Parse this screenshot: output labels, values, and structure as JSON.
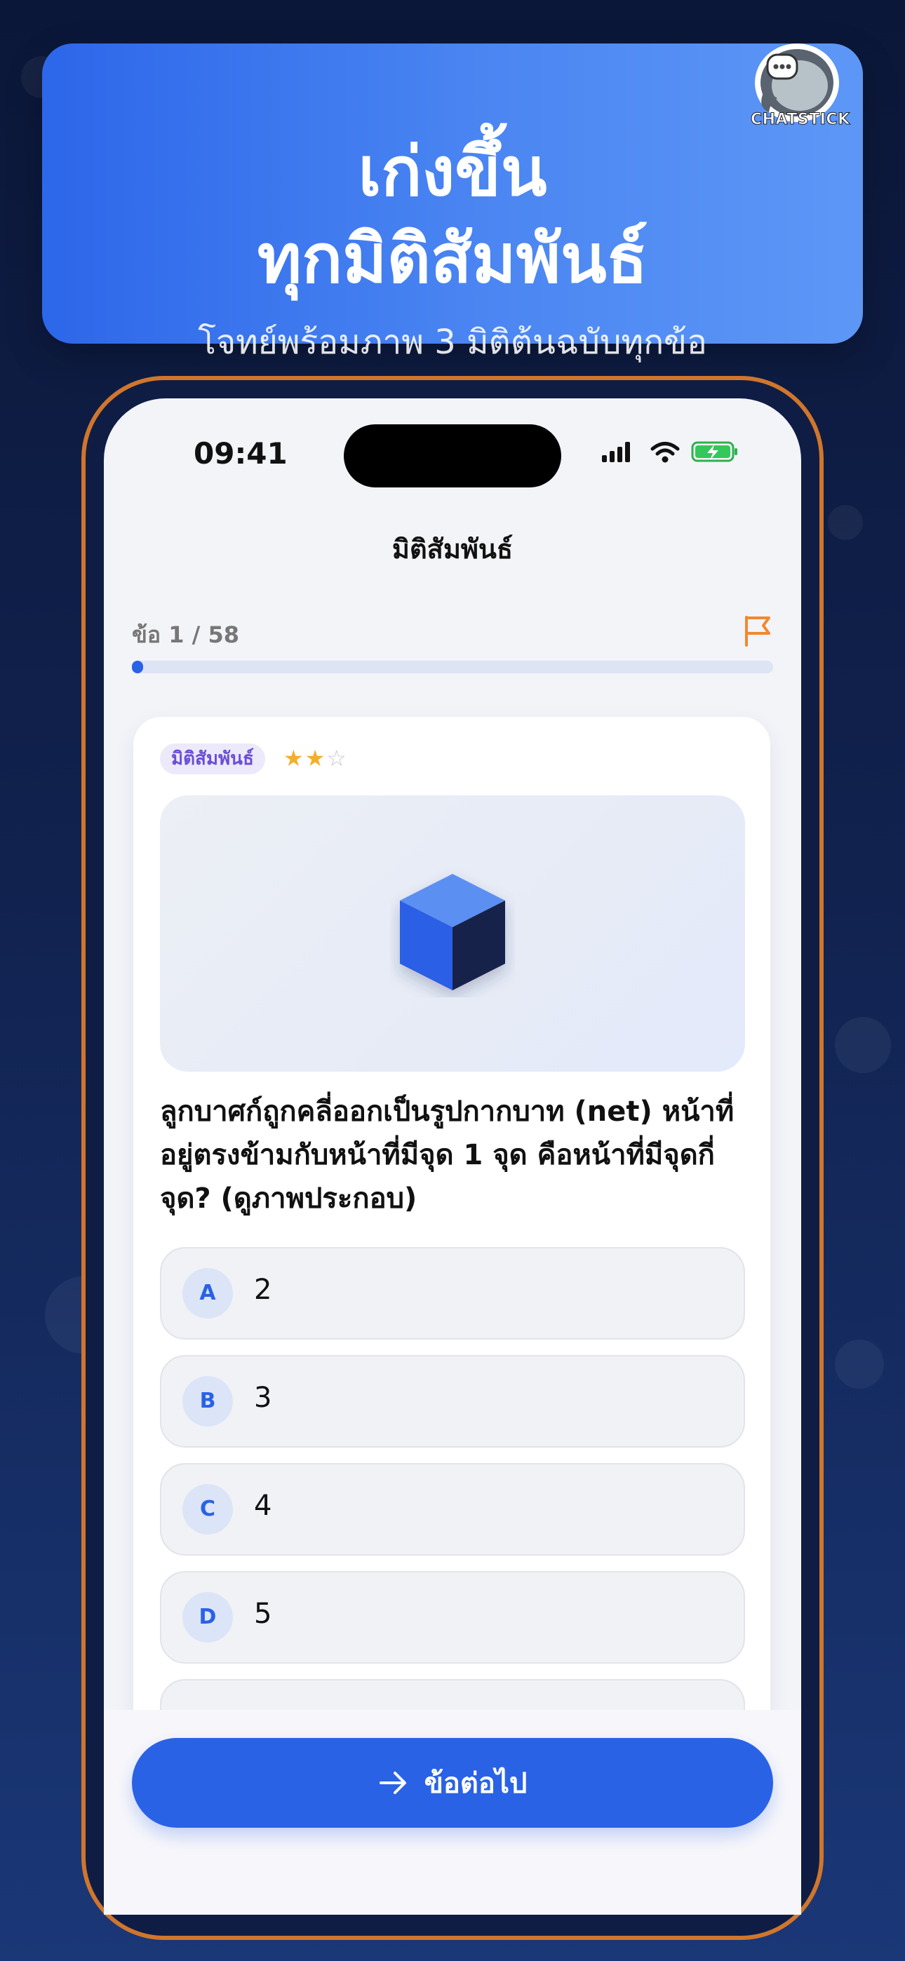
{
  "banner": {
    "line1": "เก่งขึ้น",
    "line2": "ทุกมิติสัมพันธ์",
    "subtitle": "โจทย์พร้อมภาพ 3 มิติต้นฉบับทุกข้อ",
    "logo_text": "CHATSTICK"
  },
  "status_bar": {
    "time": "09:41"
  },
  "screen": {
    "title": "มิติสัมพันธ์"
  },
  "progress": {
    "label": "ข้อ 1 / 58",
    "current": 1,
    "total": 58,
    "fraction": 0.017
  },
  "question_card": {
    "tag": "มิติสัมพันธ์",
    "difficulty": {
      "filled": 2,
      "total": 3
    },
    "text": "ลูกบาศก์ถูกคลี่ออกเป็นรูปกากบาท (net) หน้าที่อยู่ตรงข้ามกับหน้าที่มีจุด 1 จุด คือหน้าที่มีจุดกี่จุด? (ดูภาพประกอบ)",
    "options": [
      {
        "letter": "A",
        "text": "2"
      },
      {
        "letter": "B",
        "text": "3"
      },
      {
        "letter": "C",
        "text": "4"
      },
      {
        "letter": "D",
        "text": "5"
      }
    ]
  },
  "next_button": {
    "label": "ข้อต่อไป"
  },
  "colors": {
    "accent": "#2a62e6",
    "flag": "#f0892e",
    "tag_text": "#6b4fd6",
    "star": "#f2b02a"
  }
}
